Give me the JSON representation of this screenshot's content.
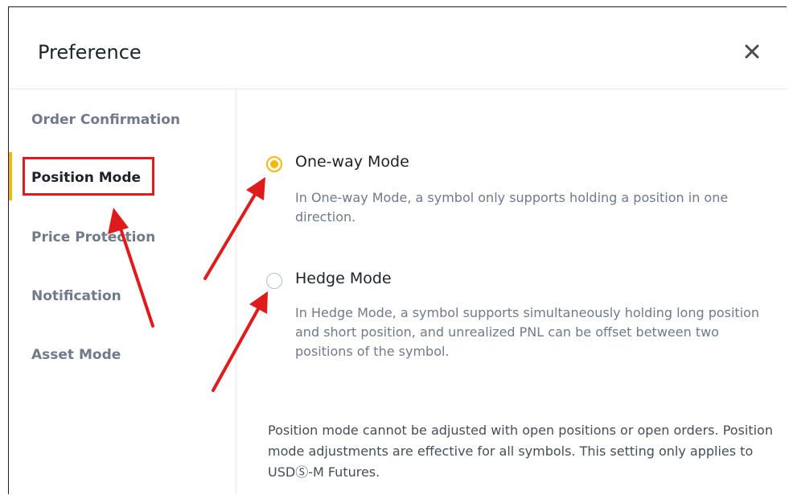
{
  "dialog": {
    "title": "Preference",
    "close_icon": "close-icon"
  },
  "sidebar": {
    "items": [
      {
        "label": "Order Confirmation",
        "active": false
      },
      {
        "label": "Position Mode",
        "active": true
      },
      {
        "label": "Price Protection",
        "active": false
      },
      {
        "label": "Notification",
        "active": false
      },
      {
        "label": "Asset Mode",
        "active": false
      }
    ]
  },
  "position_mode": {
    "options": [
      {
        "label": "One-way Mode",
        "checked": true,
        "description": "In One-way Mode, a symbol only supports holding a position in one direction."
      },
      {
        "label": "Hedge Mode",
        "checked": false,
        "description": "In Hedge Mode, a symbol supports simultaneously holding long position and short position, and unrealized PNL can be offset between two positions of the symbol."
      }
    ],
    "note": "Position mode cannot be adjusted with open positions or open orders. Position mode adjustments are effective for all symbols. This setting only applies to USDⓈ-M Futures."
  },
  "colors": {
    "accent": "#f0b90b",
    "annotation": "#e01b1b",
    "text_primary": "#1e2329",
    "text_secondary": "#707a8a"
  }
}
